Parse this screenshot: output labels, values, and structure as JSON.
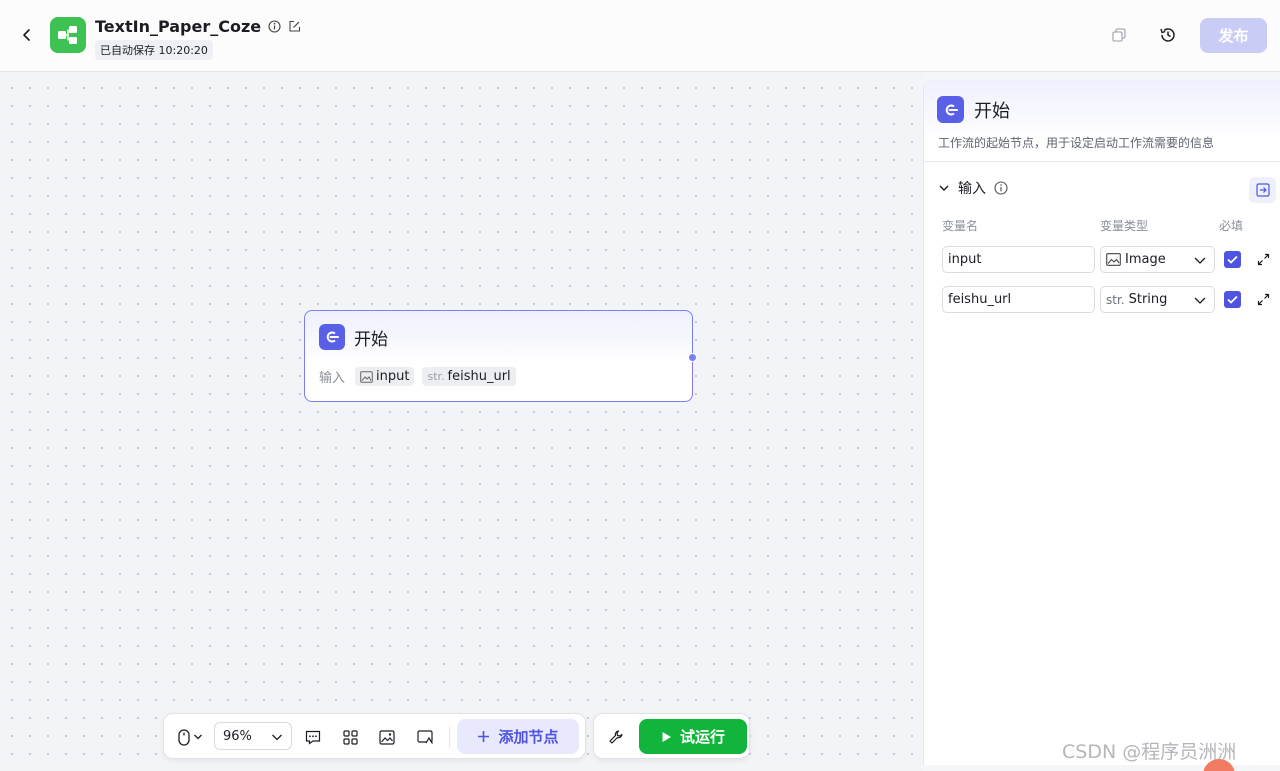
{
  "header": {
    "title": "TextIn_Paper_Coze",
    "autosave_text": "已自动保存 10:20:20",
    "publish_label": "发布",
    "icons": [
      "chevron-left-icon",
      "workflow-logo-icon",
      "info-icon",
      "edit-icon",
      "copy-icon",
      "history-icon"
    ]
  },
  "canvas": {
    "node": {
      "title": "开始",
      "io_label": "输入",
      "inputs": [
        {
          "prefix_icon": "image-icon",
          "name": "input"
        },
        {
          "prefix": "str.",
          "name": "feishu_url"
        }
      ]
    }
  },
  "toolbar": {
    "zoom": "96%",
    "add_node_label": "添加节点",
    "run_label": "试运行",
    "icons": [
      "mouse-icon",
      "comment-icon",
      "layout-icon",
      "image-icon",
      "minimap-icon",
      "plus-icon",
      "wrench-icon",
      "play-icon"
    ]
  },
  "panel": {
    "title": "开始",
    "description": "工作流的起始节点，用于设定启动工作流需要的信息",
    "section_title": "输入",
    "columns": {
      "name": "变量名",
      "type": "变量类型",
      "required": "必填"
    },
    "variables": [
      {
        "name": "input",
        "type_prefix_icon": "image-icon",
        "type": "Image",
        "required": true
      },
      {
        "name": "feishu_url",
        "type_prefix": "str.",
        "type": "String",
        "required": true
      }
    ]
  },
  "watermark": "CSDN @程序员洲洲",
  "colors": {
    "accent": "#4e53e2",
    "run": "#11b53c",
    "logo": "#3ec254",
    "publish_disabled": "#c9ccf5"
  }
}
